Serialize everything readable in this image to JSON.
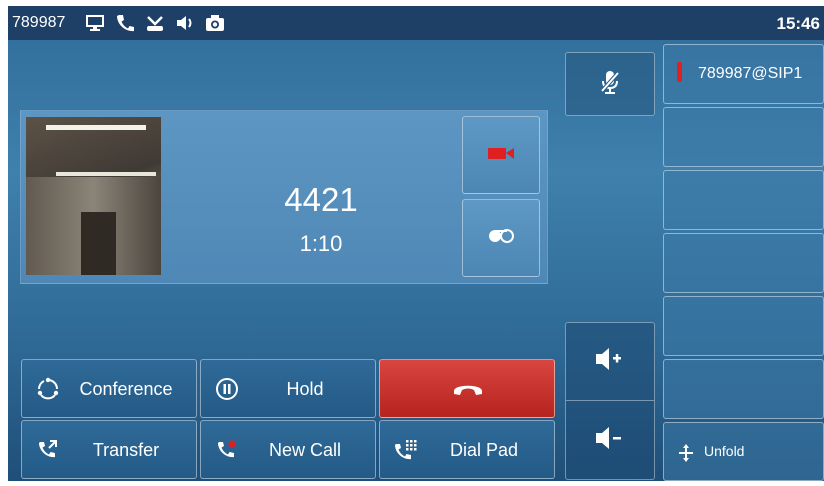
{
  "status": {
    "account": "789987",
    "time": "15:46",
    "icons": [
      "screen-icon",
      "phone-icon",
      "missed-call-icon",
      "speaker-icon",
      "camera-icon"
    ]
  },
  "call": {
    "number": "4421",
    "duration": "1:10"
  },
  "lines": [
    {
      "label": "789987@SIP1",
      "active": true
    },
    {
      "label": ""
    },
    {
      "label": ""
    },
    {
      "label": ""
    },
    {
      "label": ""
    },
    {
      "label": ""
    }
  ],
  "unfold": {
    "label": "Unfold"
  },
  "softkeys": {
    "conference": "Conference",
    "hold": "Hold",
    "transfer": "Transfer",
    "new_call": "New Call",
    "dial_pad": "Dial Pad"
  },
  "colors": {
    "status_bar": "#1e3f66",
    "end_call": "#c9302c",
    "video_icon": "#e02020",
    "line_indicator": "#e02020"
  }
}
